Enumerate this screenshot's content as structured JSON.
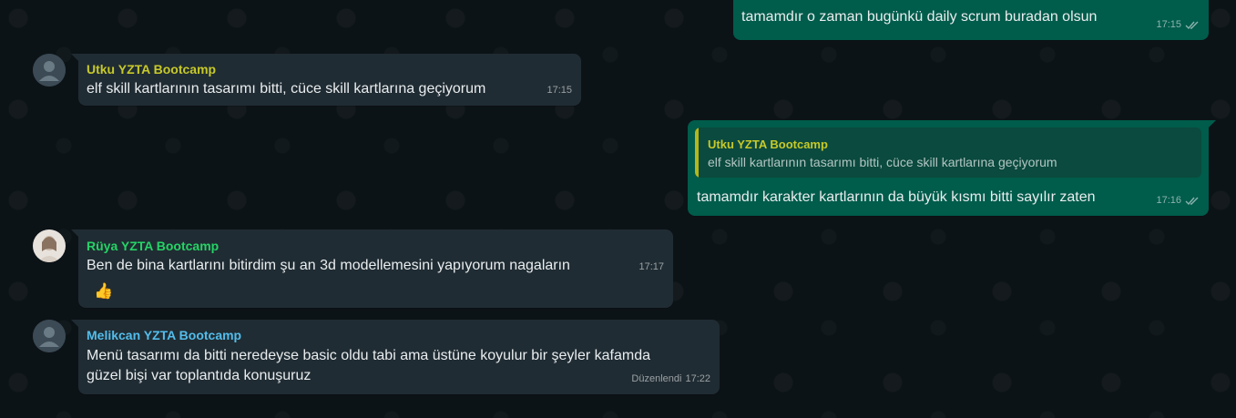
{
  "colors": {
    "outgoing": "#005c4b",
    "incoming": "#202c33",
    "utku_name": "#c7c929",
    "ruya_name": "#25d366",
    "melikcan_name": "#53bdeb"
  },
  "messages": [
    {
      "id": "m1",
      "direction": "out",
      "text": "tamamdır o zaman bugünkü daily scrum buradan olsun",
      "time": "17:15",
      "status_icon": "double-check-icon"
    },
    {
      "id": "m2",
      "direction": "in",
      "sender": "Utku YZTA Bootcamp",
      "text": "elf skill kartlarının tasarımı bitti, cüce skill kartlarına geçiyorum",
      "time": "17:15",
      "avatar_icon": "default-avatar-icon"
    },
    {
      "id": "m3",
      "direction": "out",
      "quote": {
        "sender": "Utku YZTA Bootcamp",
        "text": "elf skill kartlarının tasarımı bitti, cüce skill kartlarına geçiyorum"
      },
      "text": "tamamdır karakter kartlarının da büyük kısmı bitti sayılır zaten",
      "time": "17:16",
      "status_icon": "double-check-icon"
    },
    {
      "id": "m4",
      "direction": "in",
      "sender": "Rüya YZTA Bootcamp",
      "text": "Ben de bina kartlarını bitirdim şu an 3d modellemesini yapıyorum nagaların",
      "time": "17:17",
      "reaction": "👍",
      "avatar_icon": "profile-photo-avatar"
    },
    {
      "id": "m5",
      "direction": "in",
      "sender": "Melikcan YZTA Bootcamp",
      "text_line1": "Menü tasarımı da bitti neredeyse basic oldu tabi ama üstüne koyulur bir şeyler kafamda",
      "text_line2": "güzel bişi var toplantıda konuşuruz",
      "edited_label": "Düzenlendi",
      "time": "17:22",
      "avatar_icon": "default-avatar-icon"
    }
  ]
}
